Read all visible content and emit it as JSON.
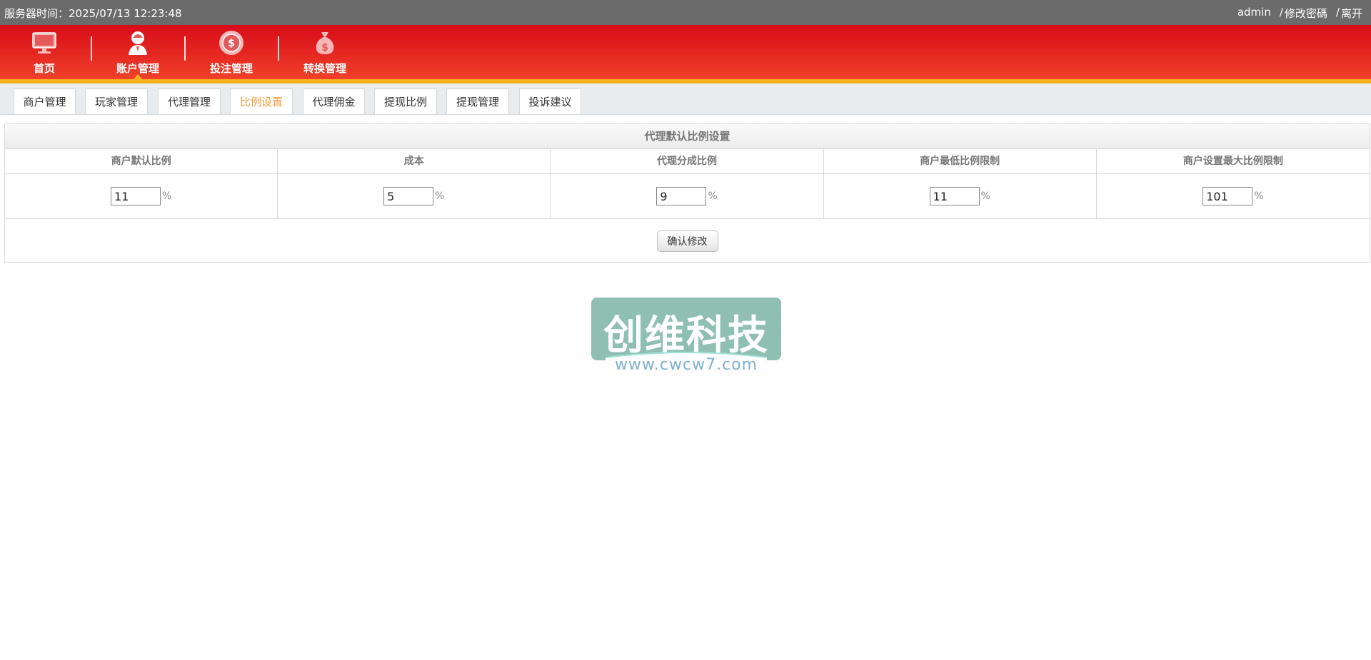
{
  "topbar": {
    "server_time": "服务器时间：2025/07/13 12:23:48",
    "user": "admin",
    "sep1": "/",
    "change_password": "修改密碼",
    "sep2": "/",
    "logout": "离开"
  },
  "nav": {
    "items": [
      {
        "label": "首页",
        "icon": "monitor-icon"
      },
      {
        "label": "账户管理",
        "icon": "user-icon"
      },
      {
        "label": "投注管理",
        "icon": "chip-icon"
      },
      {
        "label": "转换管理",
        "icon": "money-bag-icon"
      }
    ],
    "active": 1,
    "colors": {
      "start": "#d80c18",
      "end": "#f0402a",
      "accent": "#f7b11e"
    }
  },
  "tabs": [
    {
      "label": "商户管理"
    },
    {
      "label": "玩家管理"
    },
    {
      "label": "代理管理"
    },
    {
      "label": "比例设置",
      "active": true
    },
    {
      "label": "代理佣金"
    },
    {
      "label": "提现比例"
    },
    {
      "label": "提现管理"
    },
    {
      "label": "投诉建议"
    }
  ],
  "panel": {
    "title": "代理默认比例设置",
    "headers": [
      "商户默认比例",
      "成本",
      "代理分成比例",
      "商户最低比例限制",
      "商户设置最大比例限制"
    ],
    "values": [
      "11",
      "5",
      "9",
      "11",
      "101"
    ],
    "unit": "%",
    "confirm_label": "确认修改"
  },
  "watermark": {
    "main": "创维科技",
    "url": "www.cwcw7.com"
  },
  "colors": {
    "topbar": "#6b6b6b",
    "active_tab": "#f39c3c",
    "watermark_bg": "#8fbfb3"
  }
}
